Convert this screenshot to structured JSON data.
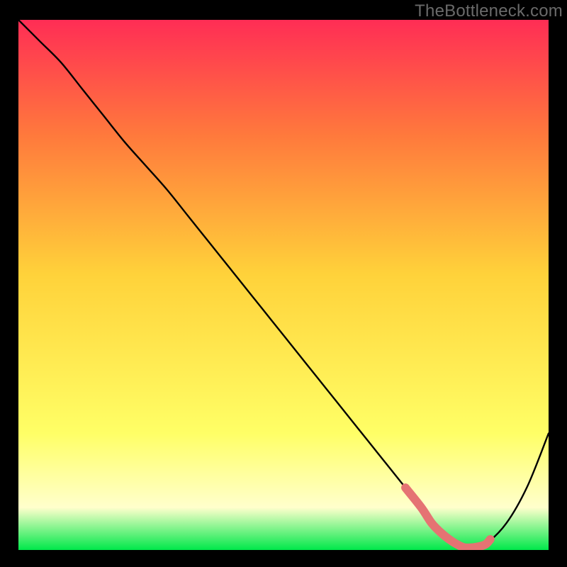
{
  "watermark": "TheBottleneck.com",
  "colors": {
    "frame_bg": "#000000",
    "gradient_top": "#ff2d55",
    "gradient_mid_upper": "#ff7a3c",
    "gradient_mid": "#ffd23a",
    "gradient_mid_lower": "#ffff66",
    "gradient_pale": "#ffffcc",
    "gradient_bottom": "#00e84a",
    "curve": "#000000",
    "mask_band": "#e57373"
  },
  "chart_data": {
    "type": "line",
    "title": "",
    "xlabel": "",
    "ylabel": "",
    "xlim": [
      0,
      100
    ],
    "ylim": [
      0,
      100
    ],
    "series": [
      {
        "name": "bottleneck-curve",
        "x": [
          0,
          4,
          8,
          12,
          16,
          20,
          24,
          28,
          32,
          36,
          40,
          44,
          48,
          52,
          56,
          60,
          64,
          68,
          72,
          76,
          78,
          80,
          82,
          84,
          86,
          88,
          92,
          96,
          100
        ],
        "y": [
          100,
          96,
          92,
          87,
          82,
          77,
          72.5,
          68,
          63,
          58,
          53,
          48,
          43,
          38,
          33,
          28,
          23,
          18,
          13,
          8,
          5,
          3,
          1.5,
          0.5,
          0.5,
          1,
          5,
          12,
          22
        ]
      }
    ],
    "mask_band": {
      "x_start": 73,
      "x_end": 89,
      "y_approx": 2
    }
  }
}
